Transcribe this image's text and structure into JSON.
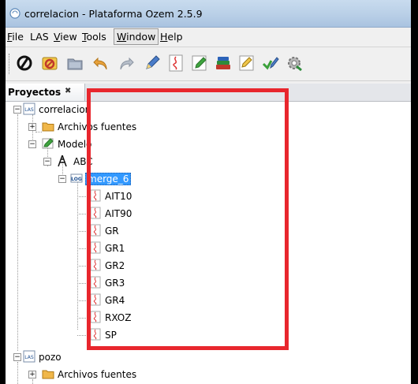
{
  "window": {
    "title": "correlacion - Plataforma Ozem 2.5.9"
  },
  "menubar": [
    {
      "label": "File",
      "mnemonic": "F",
      "rest": "ile"
    },
    {
      "label": "LAS",
      "mnemonic": "",
      "rest": "LAS"
    },
    {
      "label": "View",
      "mnemonic": "V",
      "rest": "iew"
    },
    {
      "label": "Tools",
      "mnemonic": "T",
      "rest": "ools"
    },
    {
      "label": "Window",
      "mnemonic": "W",
      "rest": "indow"
    },
    {
      "label": "Help",
      "mnemonic": "H",
      "rest": "elp"
    }
  ],
  "toolbar": [
    "ozem-logo-icon",
    "open-project-icon",
    "folder-icon",
    "undo-icon",
    "redo-icon",
    "pen-icon",
    "curve-icon",
    "edit-icon",
    "books-icon",
    "pencil-doc-icon",
    "check-pen-icon",
    "settings-icon"
  ],
  "panel": {
    "title": "Proyectos",
    "close_glyph": "✖"
  },
  "tree": {
    "project1": {
      "label": "correlacion",
      "icon_text": "LAS"
    },
    "archivos1": {
      "label": "Archivos fuentes"
    },
    "modelo": {
      "label": "Modelo"
    },
    "abc": {
      "label": "ABC"
    },
    "merge": {
      "label": "merge_6",
      "icon_text": "LOG"
    },
    "curves": [
      "AIT10",
      "AIT90",
      "GR",
      "GR1",
      "GR2",
      "GR3",
      "GR4",
      "RXOZ",
      "SP"
    ],
    "project2": {
      "label": "pozo",
      "icon_text": "LAS"
    },
    "archivos2": {
      "label": "Archivos fuentes"
    }
  },
  "colors": {
    "highlight": "#e8262d",
    "selection": "#3399ff",
    "titlebar": "#b9cfe7"
  }
}
